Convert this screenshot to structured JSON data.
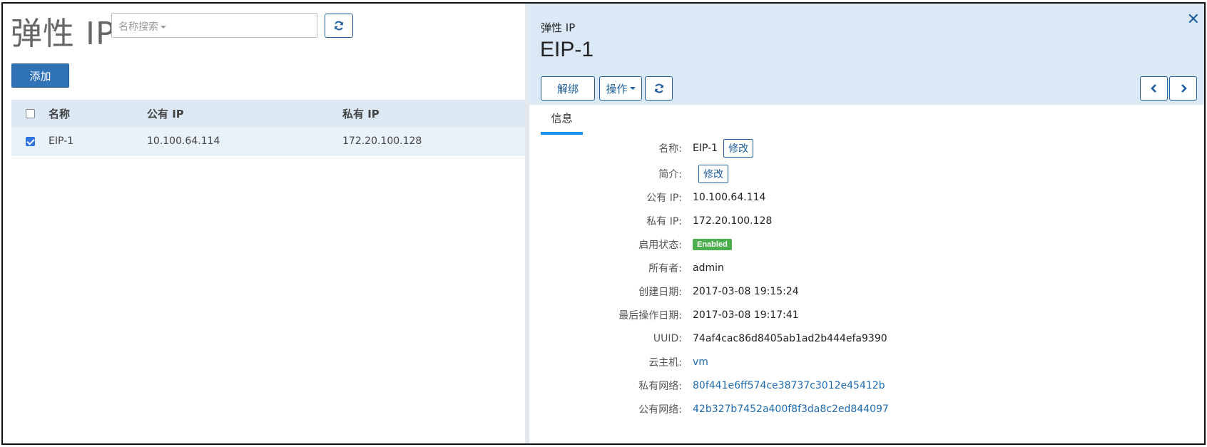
{
  "list": {
    "title": "弹性 IP",
    "search_placeholder": "名称搜索",
    "add_label": "添加",
    "columns": [
      "名称",
      "公有 IP",
      "私有 IP"
    ],
    "rows": [
      {
        "name": "EIP-1",
        "public_ip": "10.100.64.114",
        "private_ip": "172.20.100.128",
        "checked": true
      }
    ]
  },
  "detail": {
    "subtitle": "弹性 IP",
    "title": "EIP-1",
    "unbind_label": "解绑",
    "actions_label": "操作",
    "tab_info": "信息",
    "edit_label": "修改",
    "fields": {
      "name": {
        "label": "名称:",
        "value": "EIP-1"
      },
      "description": {
        "label": "简介:",
        "value": ""
      },
      "public_ip": {
        "label": "公有 IP:",
        "value": "10.100.64.114"
      },
      "private_ip": {
        "label": "私有 IP:",
        "value": "172.20.100.128"
      },
      "state": {
        "label": "启用状态:",
        "value": "Enabled"
      },
      "owner": {
        "label": "所有者:",
        "value": "admin"
      },
      "created": {
        "label": "创建日期:",
        "value": "2017-03-08 19:15:24"
      },
      "last_op": {
        "label": "最后操作日期:",
        "value": "2017-03-08 19:17:41"
      },
      "uuid": {
        "label": "UUID:",
        "value": "74af4cac86d8405ab1ad2b444efa9390"
      },
      "vm": {
        "label": "云主机:",
        "value": "vm"
      },
      "private_net": {
        "label": "私有网络:",
        "value": "80f441e6ff574ce38737c3012e45412b"
      },
      "public_net": {
        "label": "公有网络:",
        "value": "42b327b7452a400f8f3da8c2ed844097"
      }
    }
  },
  "colors": {
    "primary": "#2f73b6",
    "header_bg": "#dbe9f7",
    "enabled_badge": "#4cae4c",
    "link": "#1f6bb0"
  },
  "icons": [
    "refresh-icon",
    "close-icon",
    "chevron-left-icon",
    "chevron-right-icon",
    "caret-down-icon"
  ]
}
